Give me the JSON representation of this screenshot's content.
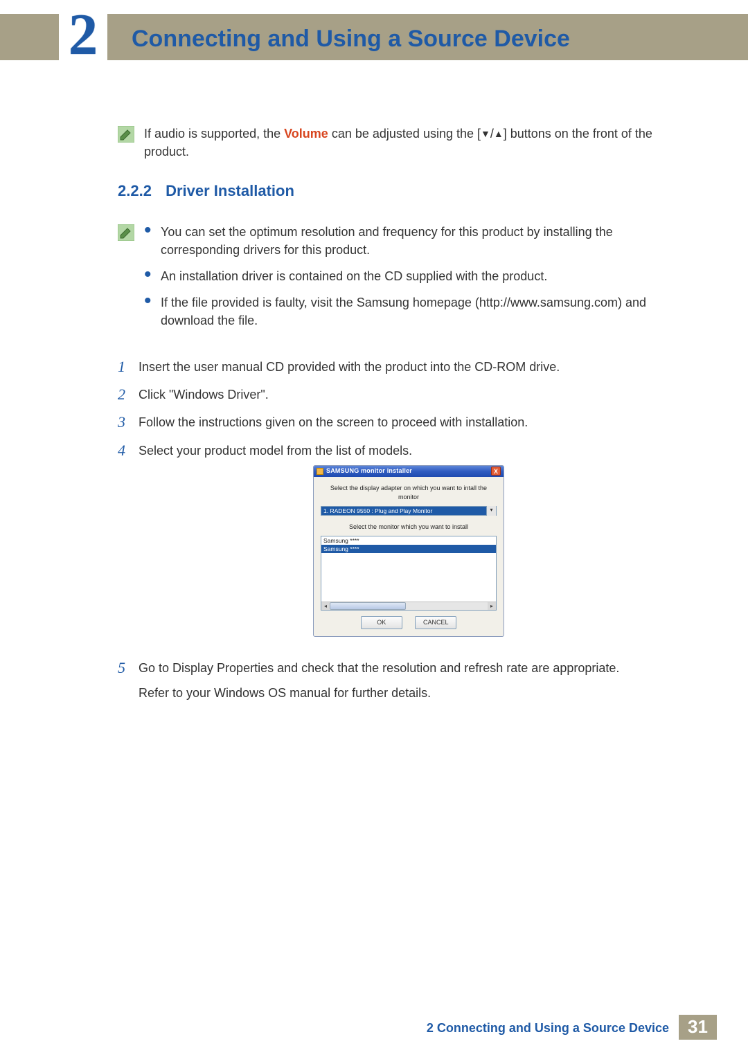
{
  "header": {
    "chapter_number": "2",
    "chapter_title": "Connecting and Using a Source Device"
  },
  "intro_note": {
    "prefix": "If audio is supported, the ",
    "highlight": "Volume",
    "mid": " can be adjusted using the [",
    "down": "▼",
    "slash": "/",
    "up": "▲",
    "suffix": "] buttons on the front of the product."
  },
  "section": {
    "number": "2.2.2",
    "title": "Driver Installation"
  },
  "bullets": [
    "You can set the optimum resolution and frequency for this product by installing the corresponding drivers for this product.",
    "An installation driver is contained on the CD supplied with the product.",
    "If the file provided is faulty, visit the Samsung homepage (http://www.samsung.com) and download the file."
  ],
  "steps": [
    {
      "n": "1",
      "text": "Insert the user manual CD provided with the product into the CD-ROM drive."
    },
    {
      "n": "2",
      "text": "Click \"Windows Driver\"."
    },
    {
      "n": "3",
      "text": "Follow the instructions given on the screen to proceed with installation."
    },
    {
      "n": "4",
      "text": "Select your product model from the list of models."
    },
    {
      "n": "5",
      "text": "Go to Display Properties and check that the resolution and refresh rate are appropriate.",
      "sub": "Refer to your Windows OS manual for further details."
    }
  ],
  "installer": {
    "title": "SAMSUNG monitor installer",
    "label_adapter": "Select the display adapter on which you want to intall the monitor",
    "adapter_value": "1. RADEON 9550 : Plug and Play Monitor",
    "label_monitor": "Select the monitor which you want to install",
    "list_item0": "Samsung ****",
    "list_item1": "Samsung ****",
    "ok": "OK",
    "cancel": "CANCEL"
  },
  "footer": {
    "chapter_ref": "2",
    "chapter_title": "Connecting and Using a Source Device",
    "page": "31"
  }
}
